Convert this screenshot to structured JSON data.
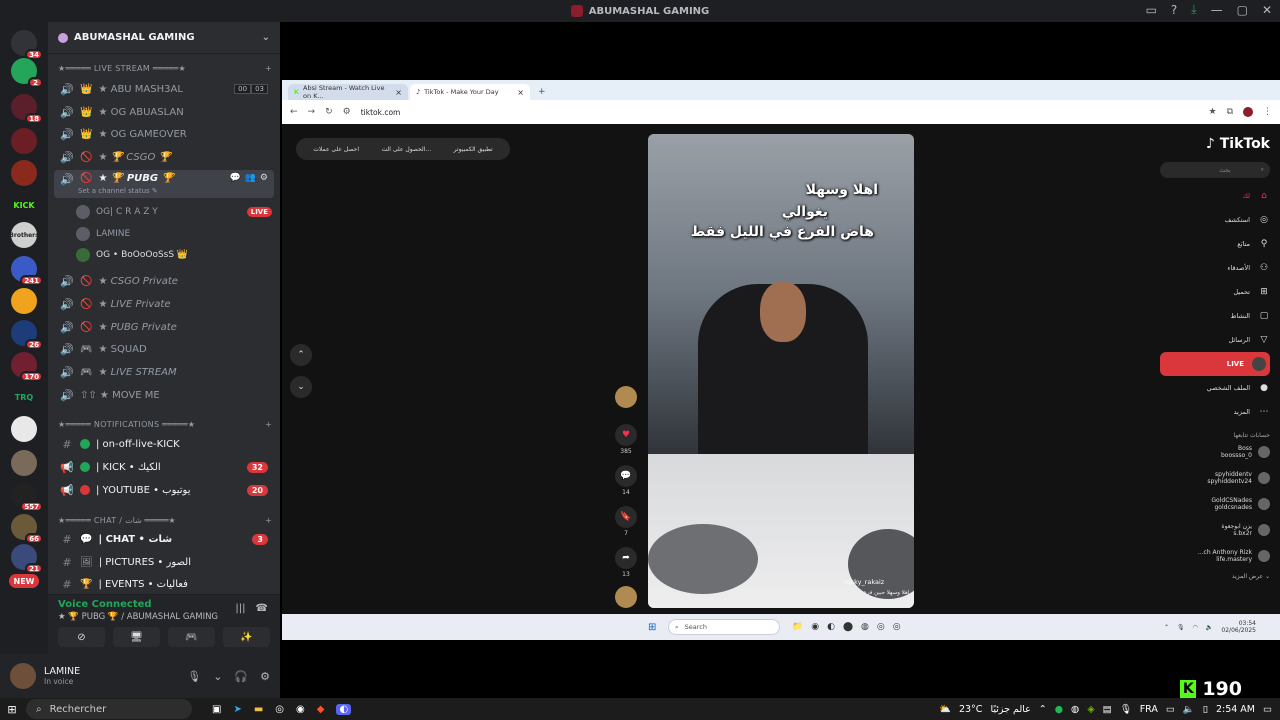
{
  "window": {
    "title": "ABUMASHAL GAMING",
    "controls": [
      "inbox-icon",
      "help-icon",
      "download-icon",
      "minimize",
      "maximize",
      "close"
    ]
  },
  "rail": [
    {
      "icon": "discord-home-icon",
      "badge": "34",
      "color": "#313338"
    },
    {
      "icon": "discord-icon",
      "badge": "2",
      "color": "#23a55a"
    },
    {
      "icon": "server",
      "badge": "18",
      "color": "#5a1f2a"
    },
    {
      "icon": "server",
      "badge": "",
      "color": "#6b1f24"
    },
    {
      "icon": "server",
      "badge": "",
      "color": "#8a2a1c"
    },
    {
      "icon": "kick",
      "badge": "",
      "label": "KICK",
      "color": "#1e1f22"
    },
    {
      "icon": "brothers",
      "badge": "",
      "label": "Brothers",
      "color": "#cfcfcf"
    },
    {
      "icon": "server",
      "badge": "241",
      "color": "#3a5bc7"
    },
    {
      "icon": "pubg",
      "badge": "",
      "color": "#f0a41e"
    },
    {
      "icon": "server",
      "badge": "26",
      "color": "#1d3c7a"
    },
    {
      "icon": "server",
      "badge": "170",
      "color": "#702030"
    },
    {
      "icon": "trq",
      "badge": "",
      "label": "TRQ",
      "color": "#1e1f22"
    },
    {
      "icon": "server",
      "badge": "",
      "color": "#e8e8e8"
    },
    {
      "icon": "server",
      "badge": "",
      "color": "#7a6a5a"
    },
    {
      "icon": "server",
      "badge": "557",
      "color": "#222"
    },
    {
      "icon": "server",
      "badge": "66",
      "color": "#6a5a3a"
    },
    {
      "icon": "server",
      "badge": "21",
      "color": "#3a4a7a"
    },
    {
      "icon": "new",
      "badge": "",
      "label": "NEW",
      "color": "#da373c"
    }
  ],
  "sidebar": {
    "server_name": "ABUMASHAL GAMING",
    "categories": {
      "live": "★═════ LIVE STREAM ═════★",
      "notif": "★═════ NOTIFICATIONS ═════★",
      "chat": "★═════ CHAT / شات ═════★"
    },
    "voice_channels": [
      {
        "name": "★ ABU MASH3AL",
        "emoji": "👑",
        "boxes": [
          "00",
          "03"
        ]
      },
      {
        "name": "★ OG ABUASLAN",
        "emoji": "👑"
      },
      {
        "name": "★ OG GAMEOVER",
        "emoji": "👑"
      },
      {
        "name": "★ 🏆 CSGO 🏆",
        "emoji": "🚫"
      },
      {
        "name": "★ 🏆 PUBG 🏆",
        "emoji": "🚫",
        "status": "Set a channel status ✎"
      },
      {
        "name": "★ CSGO Private",
        "emoji": "🚫"
      },
      {
        "name": "★ LIVE Private",
        "emoji": "🚫"
      },
      {
        "name": "★ PUBG Private",
        "emoji": "🚫"
      },
      {
        "name": "★ SQUAD",
        "emoji": "🎮"
      },
      {
        "name": "★ LIVE STREAM",
        "emoji": "🎮"
      },
      {
        "name": "⇧⇧ ★ MOVE ME",
        "emoji": ""
      }
    ],
    "voice_users": [
      {
        "name": "OG| C R A Z Y",
        "live": "LIVE"
      },
      {
        "name": "LAMINE"
      },
      {
        "name": "OG • BoOoOoSsS 👑"
      }
    ],
    "text_channels": [
      {
        "name": "| on-off-live-KICK",
        "count": ""
      },
      {
        "name": "| KICK • الكيك",
        "count": "32"
      },
      {
        "name": "| YOUTUBE • يوتيوب",
        "count": "20"
      },
      {
        "name": "| CHAT • شات",
        "count": "3"
      },
      {
        "name": "| PICTURES • الصور",
        "count": ""
      },
      {
        "name": "| EVENTS • فعاليات",
        "count": ""
      }
    ]
  },
  "voice_panel": {
    "status": "Voice Connected",
    "channel": "★ 🏆 PUBG 🏆 / ABUMASHAL GAMING"
  },
  "user_panel": {
    "name": "LAMINE",
    "sub": "In voice"
  },
  "browser": {
    "tabs": [
      {
        "label": "Absi Stream - Watch Live on K...",
        "active": false
      },
      {
        "label": "TikTok - Make Your Day",
        "active": true
      }
    ],
    "url": "tiktok.com",
    "pill_buttons": [
      "احصل على عملات",
      "الحصول على الت...",
      "تطبيق الكمبيوتر"
    ]
  },
  "tiktok": {
    "logo": "TikTok",
    "search_placeholder": "بحث",
    "nav": [
      {
        "label": "لك",
        "icon": "home-icon",
        "active": true
      },
      {
        "label": "استكشف",
        "icon": "compass-icon"
      },
      {
        "label": "متابَع",
        "icon": "follow-icon"
      },
      {
        "label": "الأصدقاء",
        "icon": "friends-icon"
      },
      {
        "label": "تحميل",
        "icon": "upload-icon"
      },
      {
        "label": "النشاط",
        "icon": "activity-icon"
      },
      {
        "label": "الرسائل",
        "icon": "messages-icon"
      },
      {
        "label": "LIVE",
        "icon": "live-icon"
      },
      {
        "label": "الملف الشخصي",
        "icon": "profile-icon"
      },
      {
        "label": "المزيد",
        "icon": "more-icon"
      }
    ],
    "following_title": "حسابات تتابعها",
    "following": [
      {
        "name": "Boss",
        "handle": "boossso_0"
      },
      {
        "name": "spyhiddentv",
        "handle": "spyhiddentv24"
      },
      {
        "name": "GoldCSNades",
        "handle": "goldcsnades"
      },
      {
        "name": "يزن ابوجعوة",
        "handle": "s.bx2r"
      },
      {
        "name": "...ch Anthony Rizk",
        "handle": "life.mastery"
      }
    ],
    "see_more": "عرض المزيد",
    "video": {
      "caption_lines": [
        "اهلا وسهلا",
        "يغوالي",
        "هاض الفرع في الليل فقط"
      ],
      "username": "rocky_rakaiz",
      "description": "اهلا وسهلا حبين فرع قرارق ورقان حمي 2"
    },
    "actions": [
      {
        "icon": "heart-icon",
        "count": "385"
      },
      {
        "icon": "comment-icon",
        "count": "14"
      },
      {
        "icon": "bookmark-icon",
        "count": "7"
      },
      {
        "icon": "share-icon",
        "count": "13"
      }
    ]
  },
  "inner_taskbar": {
    "search": "Search",
    "time": "03:54",
    "date": "02/06/2025"
  },
  "kick_viewers": "190",
  "taskbar": {
    "search": "Rechercher",
    "weather": "23°C",
    "weather_text": "عالم جزئيًا",
    "lang": "FRA",
    "time": "2:54 AM"
  }
}
